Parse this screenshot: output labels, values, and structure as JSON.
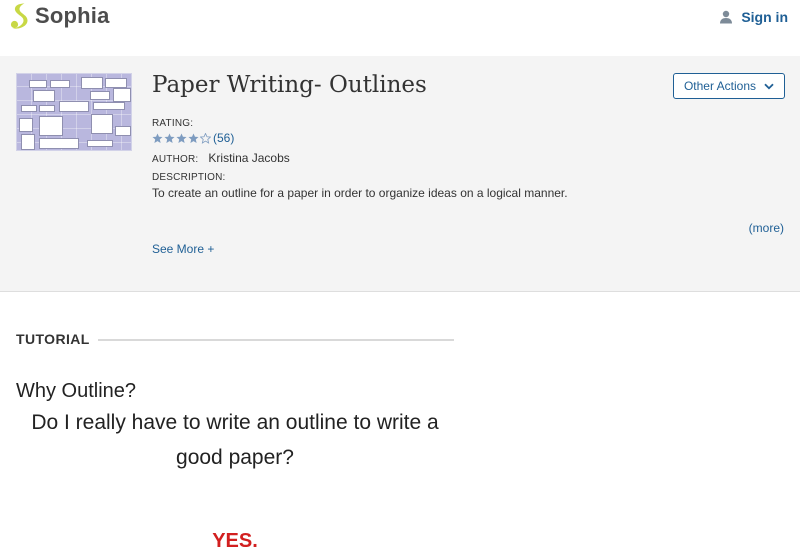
{
  "brand": {
    "name": "Sophia",
    "logo_color": "#c8d845"
  },
  "header": {
    "signin_label": "Sign in"
  },
  "lesson": {
    "title": "Paper Writing- Outlines",
    "other_actions_label": "Other Actions",
    "rating_label": "RATING:",
    "rating_stars": 4,
    "rating_count": "(56)",
    "author_label": "AUTHOR:",
    "author_name": "Kristina Jacobs",
    "description_label": "DESCRIPTION:",
    "description_text": "To create an outline for a paper in order to organize ideas on a logical manner.",
    "more_label": "(more)",
    "see_more_label": "See More +"
  },
  "tutorial": {
    "section_label": "TUTORIAL",
    "heading": "Why Outline?",
    "question": "Do I really have to write an outline to write a good paper?",
    "answer": "YES."
  },
  "colors": {
    "link": "#1f5f95",
    "star": "#7e9cc0",
    "answer": "#d21f1f"
  }
}
